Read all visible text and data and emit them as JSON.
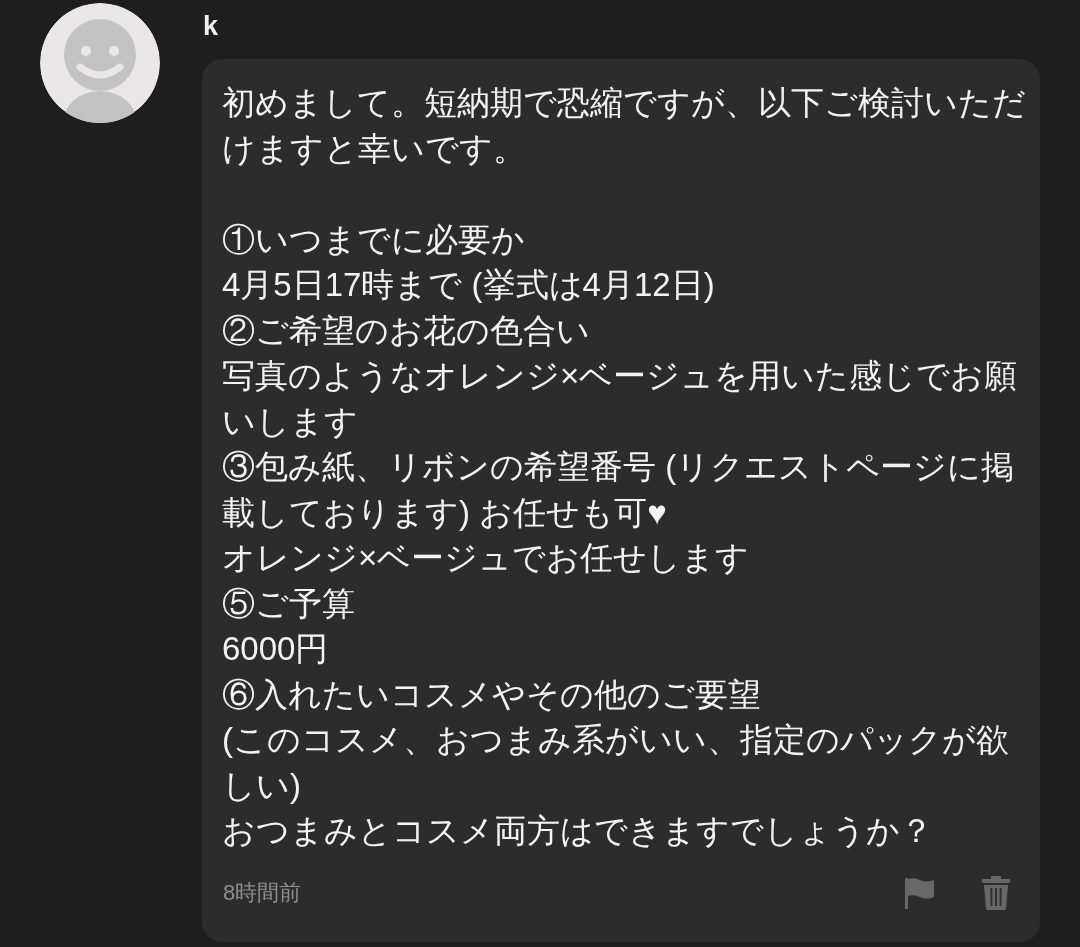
{
  "author": {
    "name": "k"
  },
  "message": {
    "intro": "初めまして。短納期で恐縮ですが、以下ご検討いただけますと幸いです。",
    "lines": [
      "①いつまでに必要か",
      "4月5日17時まで (挙式は4月12日)",
      "②ご希望のお花の色合い",
      "写真のようなオレンジ×ベージュを用いた感じでお願いします",
      "③包み紙、リボンの希望番号 (リクエストページに掲載しております) お任せも可♥",
      "オレンジ×ベージュでお任せします",
      "⑤ご予算",
      "6000円",
      "⑥入れたいコスメやその他のご要望",
      "(このコスメ、おつまみ系がいい、指定のパックが欲しい)",
      "おつまみとコスメ両方はできますでしょうか？"
    ],
    "timestamp": "8時間前"
  }
}
